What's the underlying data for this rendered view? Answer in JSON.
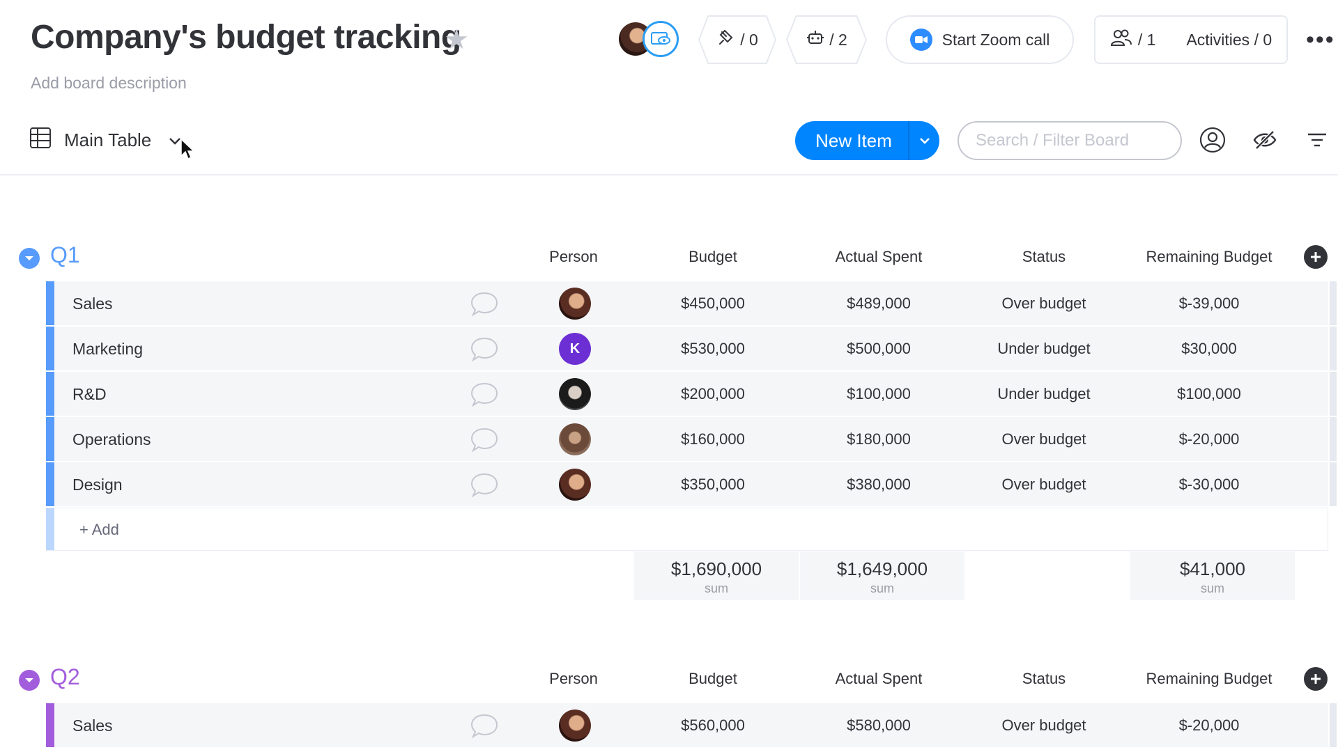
{
  "header": {
    "title": "Company's budget tracking",
    "description_placeholder": "Add board description",
    "integrations_count": "/ 0",
    "automations_count": "/ 2",
    "zoom_label": "Start Zoom call",
    "members_count": "/ 1",
    "activities_label": "Activities / 0"
  },
  "toolbar": {
    "view_label": "Main Table",
    "new_item_label": "New Item",
    "search_placeholder": "Search / Filter Board"
  },
  "columns": [
    "Person",
    "Budget",
    "Actual Spent",
    "Status",
    "Remaining Budget"
  ],
  "groups": [
    {
      "title": "Q1",
      "color": "#579bfc",
      "rows": [
        {
          "name": "Sales",
          "budget": "$450,000",
          "spent": "$489,000",
          "status": "Over budget",
          "remaining": "$-39,000",
          "person": "photo-a"
        },
        {
          "name": "Marketing",
          "budget": "$530,000",
          "spent": "$500,000",
          "status": "Under budget",
          "remaining": "$30,000",
          "person": "K"
        },
        {
          "name": "R&D",
          "budget": "$200,000",
          "spent": "$100,000",
          "status": "Under budget",
          "remaining": "$100,000",
          "person": "photo-b"
        },
        {
          "name": "Operations",
          "budget": "$160,000",
          "spent": "$180,000",
          "status": "Over budget",
          "remaining": "$-20,000",
          "person": "photo-c"
        },
        {
          "name": "Design",
          "budget": "$350,000",
          "spent": "$380,000",
          "status": "Over budget",
          "remaining": "$-30,000",
          "person": "photo-a"
        }
      ],
      "add_label": "+ Add",
      "sums": {
        "budget": "$1,690,000",
        "spent": "$1,649,000",
        "remaining": "$41,000",
        "label": "sum"
      }
    },
    {
      "title": "Q2",
      "color": "#a25ddc",
      "rows": [
        {
          "name": "Sales",
          "budget": "$560,000",
          "spent": "$580,000",
          "status": "Over budget",
          "remaining": "$-20,000",
          "person": "photo-a"
        }
      ]
    }
  ]
}
